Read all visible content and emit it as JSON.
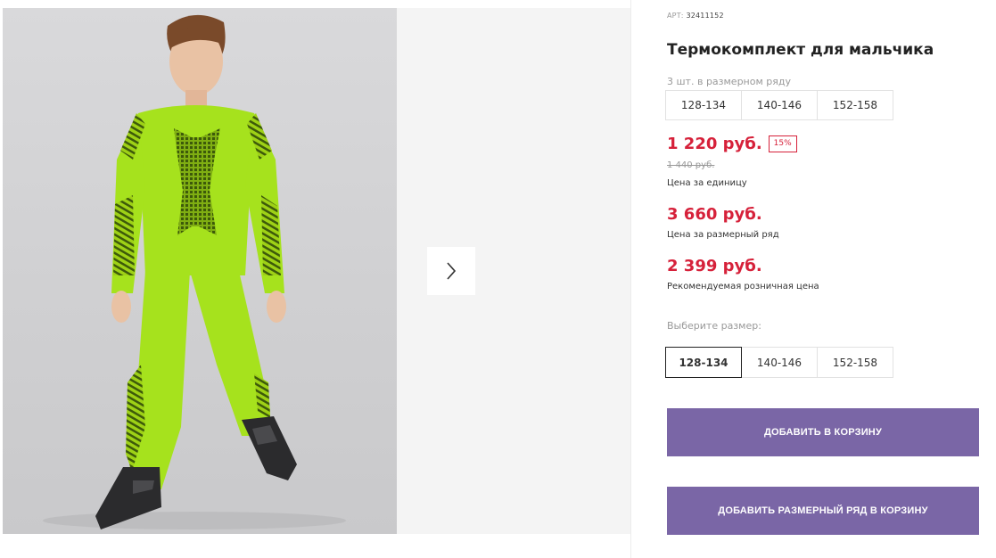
{
  "gallery": {
    "photo_alt": "boy-in-green-thermal-set",
    "next_icon": "chevron-right-icon"
  },
  "product": {
    "art_label": "АРТ:",
    "art_value": "32411152",
    "title": "Термокомплект для мальчика",
    "row_label": "3 шт. в размерном ряду",
    "row_sizes": [
      "128-134",
      "140-146",
      "152-158"
    ],
    "price": "1 220 руб.",
    "discount": "15%",
    "old_price": "1 440 руб.",
    "price_note": "Цена за единицу",
    "set_price": "3 660 руб.",
    "set_price_note": "Цена за размерный ряд",
    "rec_price": "2 399 руб.",
    "rec_price_note": "Рекомендуемая розничная цена",
    "choose_label": "Выберите размер:",
    "choose_sizes": [
      "128-134",
      "140-146",
      "152-158"
    ],
    "selected_size": "128-134",
    "add_to_cart": "ДОБАВИТЬ В КОРЗИНУ",
    "add_set_to_cart": "ДОБАВИТЬ РАЗМЕРНЫЙ РЯД В КОРЗИНУ"
  },
  "colors": {
    "accent_price": "#d6213a",
    "button_bg": "#7a66a6",
    "suit_green": "#a6e21d"
  }
}
